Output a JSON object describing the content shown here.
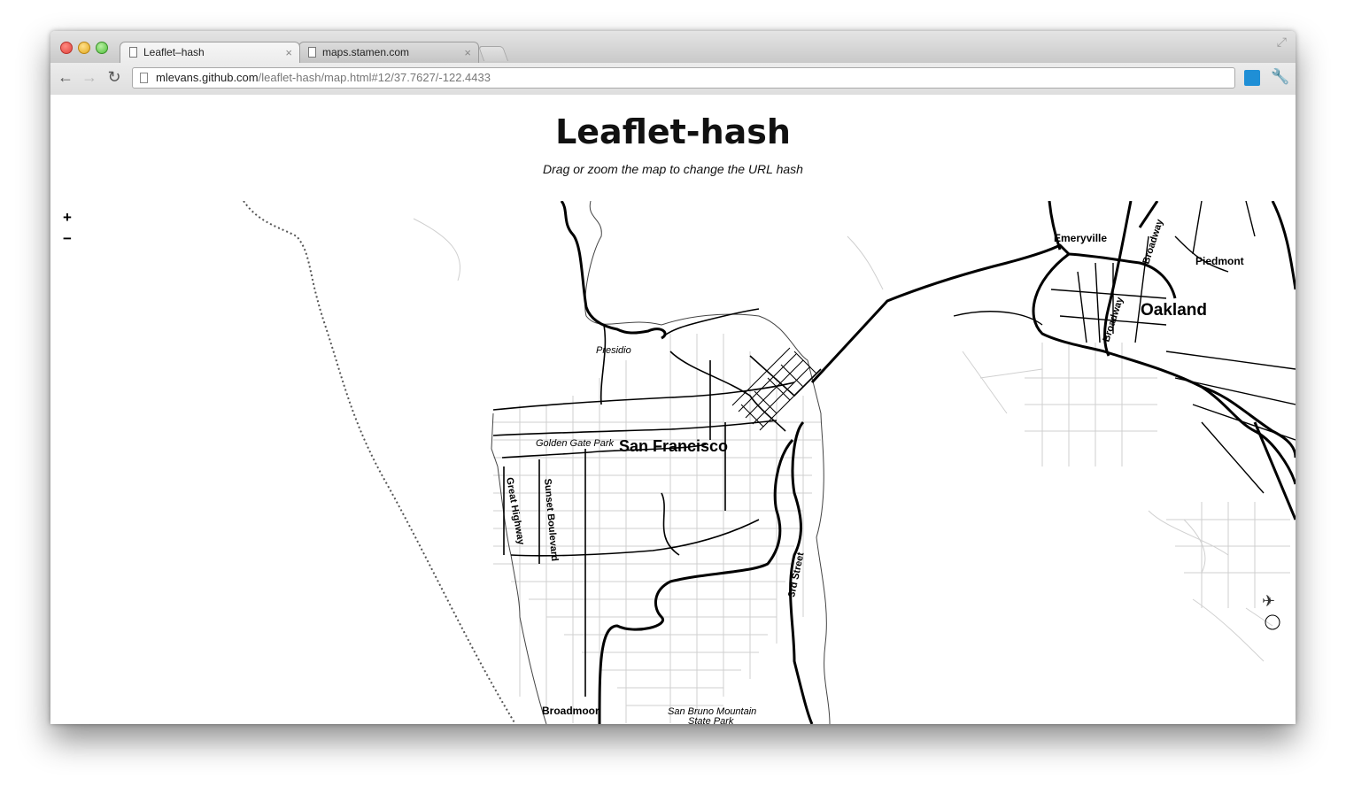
{
  "browser": {
    "tabs": [
      {
        "title": "Leaflet–hash",
        "active": true
      },
      {
        "title": "maps.stamen.com",
        "active": false
      }
    ],
    "tab_close_glyph": "×",
    "url_host": "mlevans.github.com",
    "url_path": "/leaflet-hash/map.html#12/37.7627/-122.4433",
    "icons": [
      "back-arrow-icon",
      "forward-arrow-icon",
      "reload-icon",
      "page-icon",
      "extension-icon",
      "wrench-icon",
      "fullscreen-icon"
    ]
  },
  "page": {
    "title": "Leaflet-hash",
    "subtitle": "Drag or zoom the map to change the URL hash"
  },
  "map": {
    "zoom_in_label": "+",
    "zoom_out_label": "−",
    "labels": {
      "san_francisco": "San Francisco",
      "presidio": "Presidio",
      "golden_gate_park": "Golden Gate Park",
      "great_highway": "Great Highway",
      "sunset_boulevard": "Sunset Boulevard",
      "third_street": "3rd Street",
      "broadmoor": "Broadmoor",
      "san_bruno_1": "San Bruno Mountain",
      "san_bruno_2": "State Park",
      "emeryville": "Emeryville",
      "piedmont": "Piedmont",
      "oakland": "Oakland",
      "broadway": "Broadway"
    },
    "colors": {
      "land_lines": "#000000",
      "minor_streets": "#c8c8c8"
    }
  }
}
